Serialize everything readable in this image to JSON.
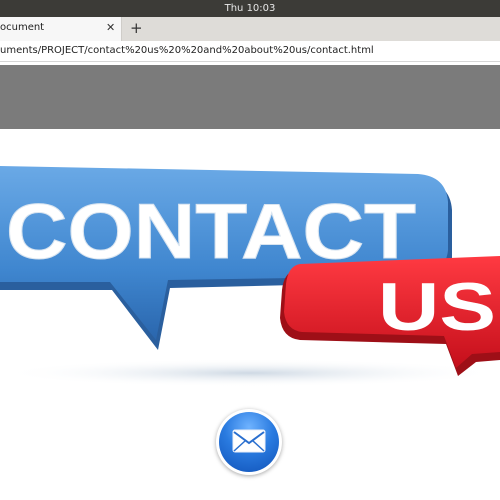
{
  "system": {
    "clock": "Thu 10:03"
  },
  "browser": {
    "tab_title": "ocument",
    "close_glyph": "✕",
    "new_tab_glyph": "+",
    "url": "uments/PROJECT/contact%20us%20%20and%20about%20us/contact.html"
  },
  "page": {
    "banner_word1": "CONTACT",
    "banner_word2": "US",
    "colors": {
      "blue_bubble": "#4a8fd4",
      "red_bubble": "#e8202e",
      "grey_band": "#7b7b7b"
    },
    "mail_button_icon": "envelope-icon"
  }
}
